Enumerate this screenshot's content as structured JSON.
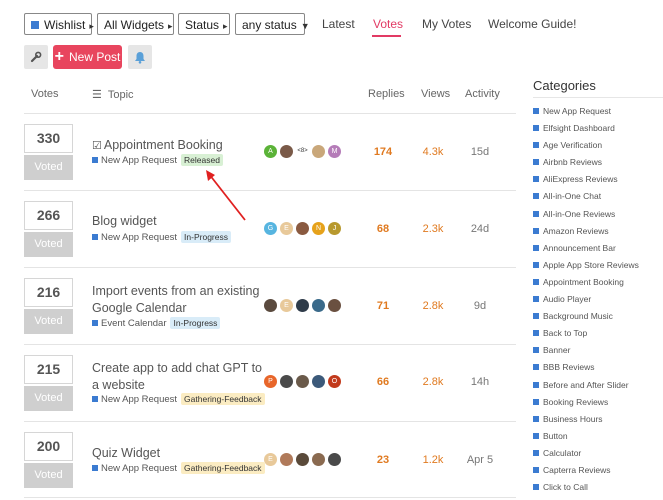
{
  "filters": {
    "wishlist": "Wishlist",
    "all_widgets": "All Widgets",
    "status": "Status",
    "any_status": "any status"
  },
  "nav": {
    "latest": "Latest",
    "votes": "Votes",
    "my_votes": "My Votes",
    "welcome": "Welcome Guide!"
  },
  "toolbar": {
    "new_post": "New Post"
  },
  "table_headers": {
    "votes": "Votes",
    "topic": "Topic",
    "replies": "Replies",
    "views": "Views",
    "activity": "Activity"
  },
  "topics": [
    {
      "votes": "330",
      "voted_label": "Voted",
      "title": "Appointment Booking",
      "category": "New App Request",
      "tag": "Released",
      "tag_color": "#d8f0d4",
      "avatars": [
        {
          "label": "A",
          "color": "#5bb338"
        },
        {
          "label": "",
          "color": "#7a5a48"
        },
        {
          "label": "<8>",
          "color": "#ffffff"
        },
        {
          "label": "",
          "color": "#c9a77a"
        },
        {
          "label": "M",
          "color": "#b57cb8"
        }
      ],
      "replies": "174",
      "views": "4.3k",
      "activity": "15d"
    },
    {
      "votes": "266",
      "voted_label": "Voted",
      "title": "Blog widget",
      "category": "New App Request",
      "tag": "In-Progress",
      "tag_color": "#d9ecf8",
      "avatars": [
        {
          "label": "G",
          "color": "#57b5e0"
        },
        {
          "label": "E",
          "color": "#e8c99a"
        },
        {
          "label": "",
          "color": "#8a5a40"
        },
        {
          "label": "N",
          "color": "#e6a21b"
        },
        {
          "label": "J",
          "color": "#b8992e"
        }
      ],
      "replies": "68",
      "views": "2.3k",
      "activity": "24d"
    },
    {
      "votes": "216",
      "voted_label": "Voted",
      "title": "Import events from an existing Google Calendar",
      "category": "Event Calendar",
      "tag": "In-Progress",
      "tag_color": "#d9ecf8",
      "avatars": [
        {
          "label": "",
          "color": "#5a4a3e"
        },
        {
          "label": "E",
          "color": "#e8c99a"
        },
        {
          "label": "",
          "color": "#2f3c4a"
        },
        {
          "label": "",
          "color": "#3a6a8a"
        },
        {
          "label": "",
          "color": "#6a5040"
        }
      ],
      "replies": "71",
      "views": "2.8k",
      "activity": "9d"
    },
    {
      "votes": "215",
      "voted_label": "Voted",
      "title": "Create app to add chat GPT to a website",
      "category": "New App Request",
      "tag": "Gathering-Feedback",
      "tag_color": "#fbecc2",
      "avatars": [
        {
          "label": "P",
          "color": "#e8662a"
        },
        {
          "label": "",
          "color": "#4a4a4a"
        },
        {
          "label": "",
          "color": "#6a5a4a"
        },
        {
          "label": "",
          "color": "#3c5a7a"
        },
        {
          "label": "O",
          "color": "#c23a1c"
        }
      ],
      "replies": "66",
      "views": "2.8k",
      "activity": "14h"
    },
    {
      "votes": "200",
      "voted_label": "Voted",
      "title": "Quiz Widget",
      "category": "New App Request",
      "tag": "Gathering-Feedback",
      "tag_color": "#fbecc2",
      "avatars": [
        {
          "label": "E",
          "color": "#e8c99a"
        },
        {
          "label": "",
          "color": "#b07a5a"
        },
        {
          "label": "",
          "color": "#5a4a3a"
        },
        {
          "label": "",
          "color": "#8a6a50"
        },
        {
          "label": "",
          "color": "#4a4a4a"
        }
      ],
      "replies": "23",
      "views": "1.2k",
      "activity": "Apr 5"
    }
  ],
  "sidebar": {
    "title": "Categories",
    "items": [
      "New App Request",
      "Elfsight Dashboard",
      "Age Verification",
      "Airbnb Reviews",
      "AliExpress Reviews",
      "All-in-One Chat",
      "All-in-One Reviews",
      "Amazon Reviews",
      "Announcement Bar",
      "Apple App Store Reviews",
      "Appointment Booking",
      "Audio Player",
      "Background Music",
      "Back to Top",
      "Banner",
      "BBB Reviews",
      "Before and After Slider",
      "Booking Reviews",
      "Business Hours",
      "Button",
      "Calculator",
      "Capterra Reviews",
      "Click to Call"
    ]
  },
  "colors": {
    "accent": "#e23a64",
    "new_post_bg": "#e8455e",
    "category_square": "#3b7bd1",
    "replies": "#e07a20",
    "annotation_arrow": "#e02020"
  }
}
